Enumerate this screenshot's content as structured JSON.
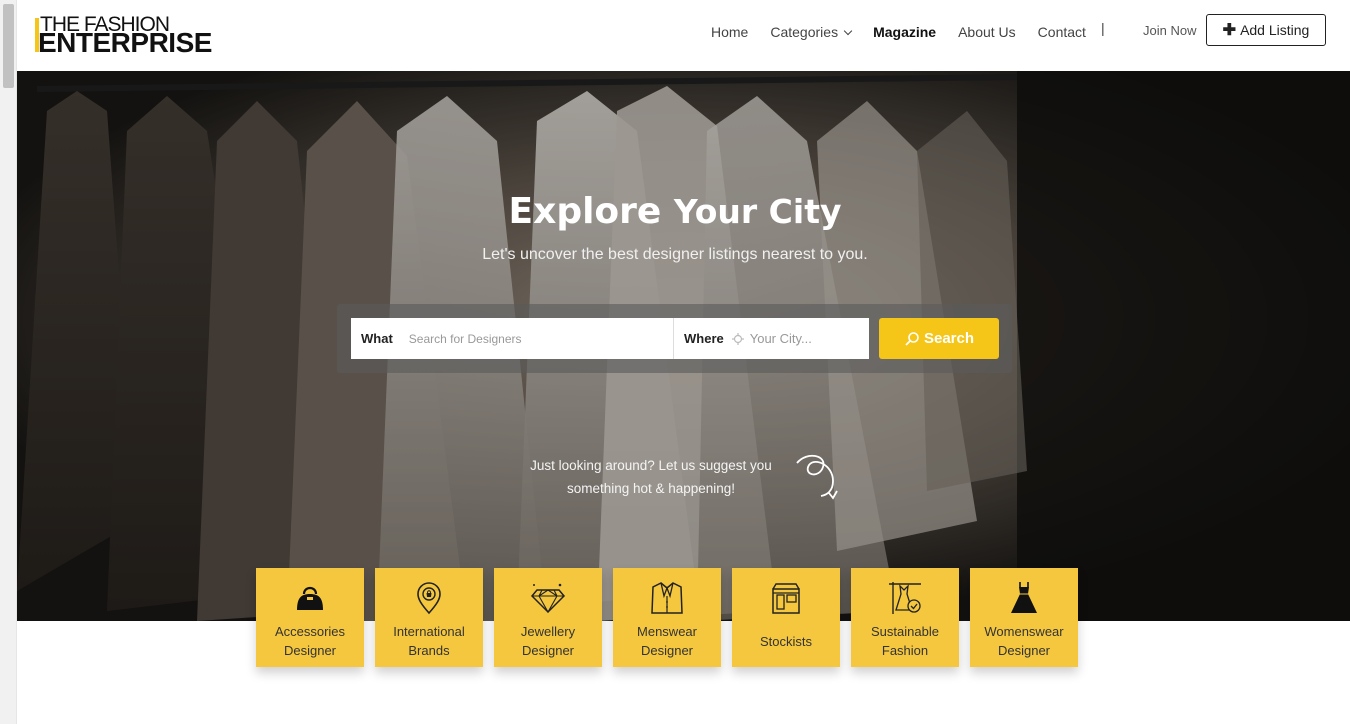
{
  "brand": {
    "logo_top": "THE FASHION",
    "logo_bottom": "ENTERPRISE"
  },
  "nav": {
    "items": [
      "Home",
      "Categories",
      "Magazine",
      "About Us",
      "Contact"
    ],
    "separator": "|",
    "join_label": "Join Now",
    "add_listing_label": "Add Listing"
  },
  "hero": {
    "title_bold": "Explore",
    "title_rest": "Your City",
    "subtitle": "Let's uncover the best designer listings nearest to you.",
    "suggest_line1": "Just looking around? Let us suggest you",
    "suggest_line2": "something hot & happening!"
  },
  "search": {
    "what_label": "What",
    "what_placeholder": "Search for Designers",
    "where_label": "Where",
    "where_placeholder": "Your City...",
    "button_label": "Search"
  },
  "categories": [
    {
      "line1": "Accessories",
      "line2": "Designer",
      "icon": "handbag-icon"
    },
    {
      "line1": "International",
      "line2": "Brands",
      "icon": "map-pin-icon"
    },
    {
      "line1": "Jewellery",
      "line2": "Designer",
      "icon": "diamond-icon"
    },
    {
      "line1": "Menswear",
      "line2": "Designer",
      "icon": "suit-jacket-icon"
    },
    {
      "line1": "Stockists",
      "line2": "",
      "icon": "store-icon"
    },
    {
      "line1": "Sustainable",
      "line2": "Fashion",
      "icon": "eco-dress-icon"
    },
    {
      "line1": "Womenswear",
      "line2": "Designer",
      "icon": "dress-icon"
    }
  ],
  "colors": {
    "accent": "#f5c518",
    "category_bg": "#f5c73f"
  }
}
